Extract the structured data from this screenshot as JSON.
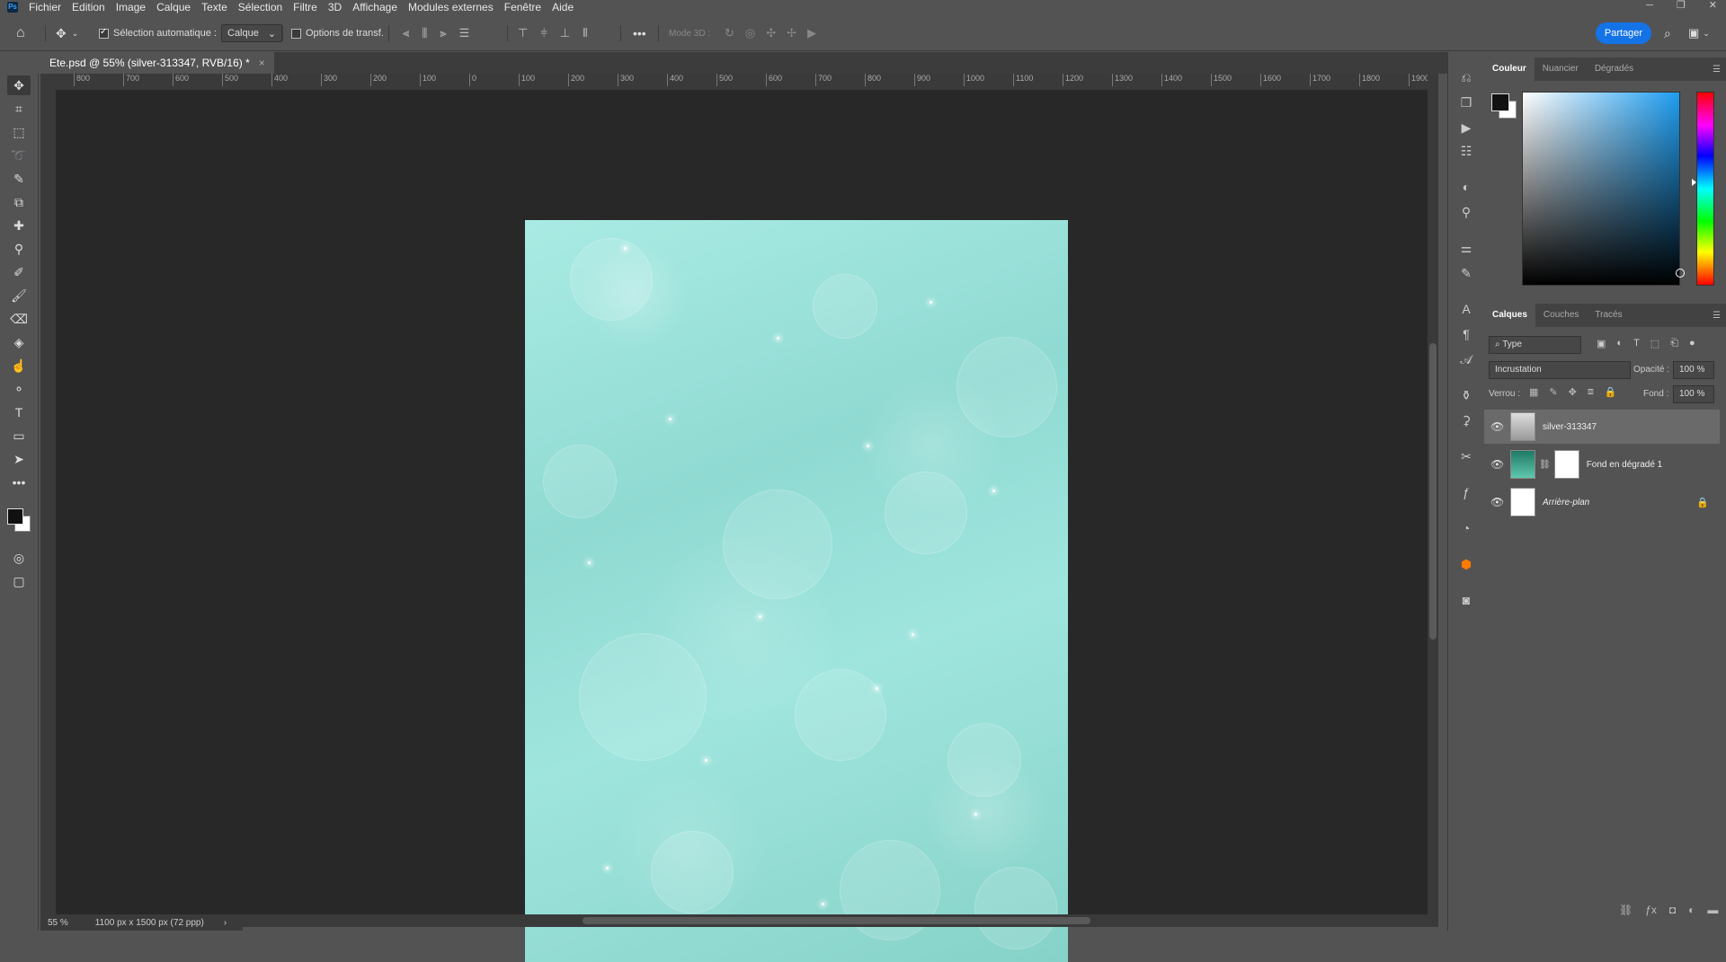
{
  "app": {
    "logo": "Ps"
  },
  "menu": [
    "Fichier",
    "Edition",
    "Image",
    "Calque",
    "Texte",
    "Sélection",
    "Filtre",
    "3D",
    "Affichage",
    "Modules externes",
    "Fenêtre",
    "Aide"
  ],
  "window_controls": [
    "─",
    "❐",
    "✕"
  ],
  "options": {
    "auto_select_label": "Sélection automatique :",
    "auto_select_target": "Calque",
    "transform_label": "Options de transf.",
    "more": "•••",
    "mode3d_label": "Mode 3D :",
    "share_label": "Partager"
  },
  "document": {
    "tab_title": "Ete.psd @ 55% (silver-313347, RVB/16) *",
    "close": "×"
  },
  "ruler": {
    "h_labels": [
      "800",
      "700",
      "600",
      "500",
      "400",
      "300",
      "200",
      "100",
      "0",
      "100",
      "200",
      "300",
      "400",
      "500",
      "600",
      "700",
      "800",
      "900",
      "1000",
      "1100",
      "1200",
      "1300",
      "1400",
      "1500",
      "1600",
      "1700",
      "1800",
      "1900"
    ]
  },
  "status": {
    "zoom": "55 %",
    "size": "1100 px x 1500 px (72 ppp)",
    "arrow": "›"
  },
  "color_panel": {
    "tabs": [
      "Couleur",
      "Nuancier",
      "Dégradés"
    ],
    "active_tab": "Couleur",
    "foreground": "#111111",
    "background": "#ffffff",
    "hue_base": "#1e9df0"
  },
  "layers_panel": {
    "tabs": [
      "Calques",
      "Couches",
      "Tracés"
    ],
    "filter": "Type",
    "blend_mode": "Incrustation",
    "opacity_label": "Opacité :",
    "opacity": "100 %",
    "lock_label": "Verrou :",
    "fill_label": "Fond :",
    "fill": "100 %",
    "layers": [
      {
        "name": "silver-313347",
        "selected": true
      },
      {
        "name": "Fond en dégradé 1",
        "selected": false
      },
      {
        "name": "Arrière-plan",
        "selected": false,
        "locked": true
      }
    ]
  },
  "colors": {
    "accent": "#1473e6",
    "canvas_bg": "#282828",
    "ui_bg": "#535353"
  }
}
